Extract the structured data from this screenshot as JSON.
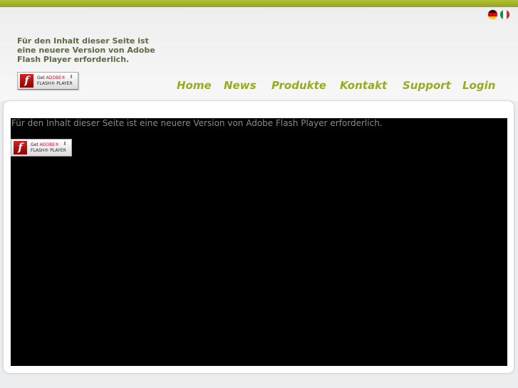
{
  "header": {
    "flash_notice": "Für den Inhalt dieser Seite ist eine neuere Version von Adobe Flash Player erforderlich."
  },
  "flash_badge": {
    "line1_get": "Get",
    "line1_brand": "ADOBE®",
    "line2": "FLASH® PLAYER",
    "logo_glyph": "f",
    "arrow": "⬇"
  },
  "languages": [
    {
      "code": "de",
      "icon": "german-flag-icon"
    },
    {
      "code": "it",
      "icon": "italian-flag-icon"
    }
  ],
  "nav": {
    "items": [
      {
        "label": "Home"
      },
      {
        "label": "News"
      },
      {
        "label": "Produkte"
      },
      {
        "label": "Kontakt"
      },
      {
        "label": "Support"
      },
      {
        "label": "Login"
      }
    ]
  },
  "content": {
    "flash_notice": "Für den Inhalt dieser Seite ist eine neuere Version von Adobe Flash Player erforderlich."
  },
  "colors": {
    "accent": "#9aaa1f",
    "topbar": "#a4b42a",
    "stage_bg": "#000000"
  }
}
